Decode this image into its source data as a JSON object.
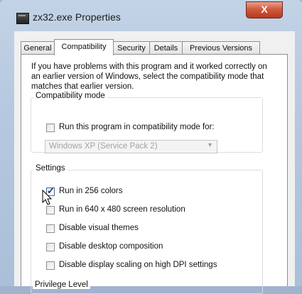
{
  "window": {
    "title": "zx32.exe Properties",
    "close_label": "X"
  },
  "tabs": [
    {
      "label": "General"
    },
    {
      "label": "Compatibility"
    },
    {
      "label": "Security"
    },
    {
      "label": "Details"
    },
    {
      "label": "Previous Versions"
    }
  ],
  "intro": "If you have problems with this program and it worked correctly on an earlier version of Windows, select the compatibility mode that matches that earlier version.",
  "compat": {
    "title": "Compatibility mode",
    "checkbox_label": "Run this program in compatibility mode for:",
    "checked": false,
    "dropdown_value": "Windows XP (Service Pack 2)"
  },
  "settings": {
    "title": "Settings",
    "options": [
      {
        "label": "Run in 256 colors",
        "checked": true
      },
      {
        "label": "Run in 640 x 480 screen resolution",
        "checked": false
      },
      {
        "label": "Disable visual themes",
        "checked": false
      },
      {
        "label": "Disable desktop composition",
        "checked": false
      },
      {
        "label": "Disable display scaling on high DPI settings",
        "checked": false
      }
    ]
  },
  "privilege": {
    "title": "Privilege Level"
  }
}
